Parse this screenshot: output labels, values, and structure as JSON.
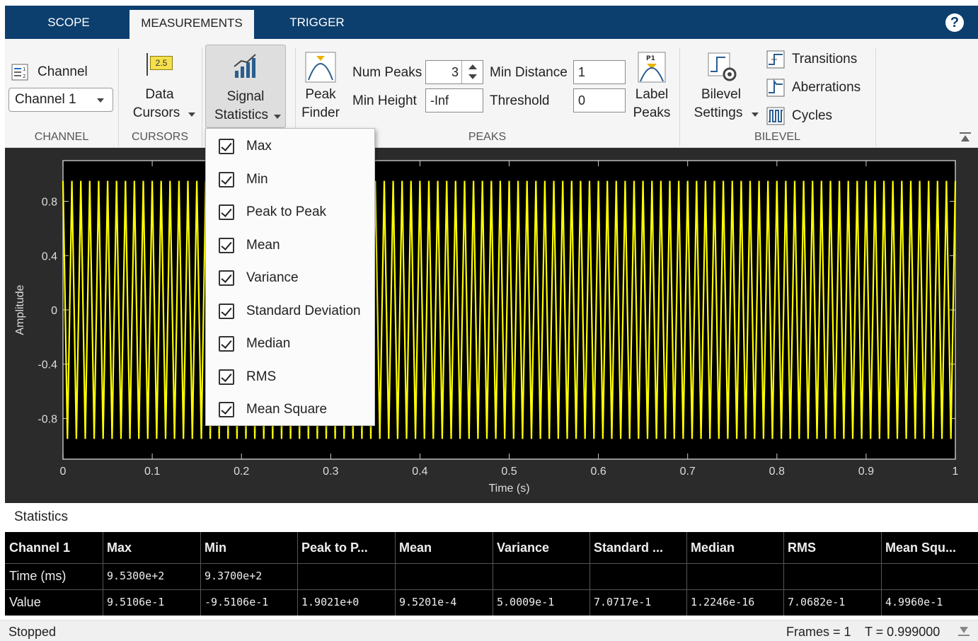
{
  "tabs": [
    {
      "label": "SCOPE",
      "active": false
    },
    {
      "label": "MEASUREMENTS",
      "active": true
    },
    {
      "label": "TRIGGER",
      "active": false
    }
  ],
  "help_label": "?",
  "ribbon": {
    "channel": {
      "button_label": "Channel",
      "dropdown_value": "Channel 1",
      "section_title": "CHANNEL"
    },
    "cursors": {
      "icon_text": "2.5",
      "button_line1": "Data",
      "button_line2": "Cursors",
      "section_title": "CURSORS"
    },
    "signal_statistics": {
      "button_line1": "Signal",
      "button_line2": "Statistics"
    },
    "peaks": {
      "peak_finder_line1": "Peak",
      "peak_finder_line2": "Finder",
      "num_peaks_label": "Num Peaks",
      "num_peaks_value": "3",
      "min_height_label": "Min Height",
      "min_height_value": "-Inf",
      "min_distance_label": "Min Distance",
      "min_distance_value": "1",
      "threshold_label": "Threshold",
      "threshold_value": "0",
      "label_peaks_icon": "P1",
      "label_peaks_line1": "Label",
      "label_peaks_line2": "Peaks",
      "section_title": "PEAKS"
    },
    "bilevel": {
      "settings_line1": "Bilevel",
      "settings_line2": "Settings",
      "transitions_label": "Transitions",
      "aberrations_label": "Aberrations",
      "cycles_label": "Cycles",
      "section_title": "BILEVEL"
    }
  },
  "menu": {
    "items": [
      {
        "label": "Max",
        "checked": true
      },
      {
        "label": "Min",
        "checked": true
      },
      {
        "label": "Peak to Peak",
        "checked": true
      },
      {
        "label": "Mean",
        "checked": true
      },
      {
        "label": "Variance",
        "checked": true
      },
      {
        "label": "Standard Deviation",
        "checked": true
      },
      {
        "label": "Median",
        "checked": true
      },
      {
        "label": "RMS",
        "checked": true
      },
      {
        "label": "Mean Square",
        "checked": true
      }
    ]
  },
  "plot": {
    "ylabel": "Amplitude",
    "xlabel": "Time (s)",
    "ytick_labels": [
      "0.8",
      "0.4",
      "0",
      "-0.4",
      "-0.8"
    ],
    "xtick_labels": [
      "0",
      "0.1",
      "0.2",
      "0.3",
      "0.4",
      "0.5",
      "0.6",
      "0.7",
      "0.8",
      "0.9",
      "1"
    ],
    "signal_color": "#ffff00",
    "background_color": "#000000",
    "amplitude": 0.951,
    "cycles": 100,
    "xlim": [
      0,
      1
    ],
    "ylim": [
      -1.1,
      1.1
    ]
  },
  "statistics": {
    "title": "Statistics",
    "headers": [
      "Channel 1",
      "Max",
      "Min",
      "Peak to P...",
      "Mean",
      "Variance",
      "Standard ...",
      "Median",
      "RMS",
      "Mean Squ..."
    ],
    "rows": [
      [
        "Time (ms)",
        "9.5300e+2",
        "9.3700e+2",
        "",
        "",
        "",
        "",
        "",
        "",
        ""
      ],
      [
        "Value",
        "9.5106e-1",
        "-9.5106e-1",
        "1.9021e+0",
        "9.5201e-4",
        "5.0009e-1",
        "7.0717e-1",
        "1.2246e-16",
        "7.0682e-1",
        "4.9960e-1"
      ]
    ]
  },
  "status": {
    "state": "Stopped",
    "frames": "Frames = 1",
    "time": "T = 0.999000"
  }
}
